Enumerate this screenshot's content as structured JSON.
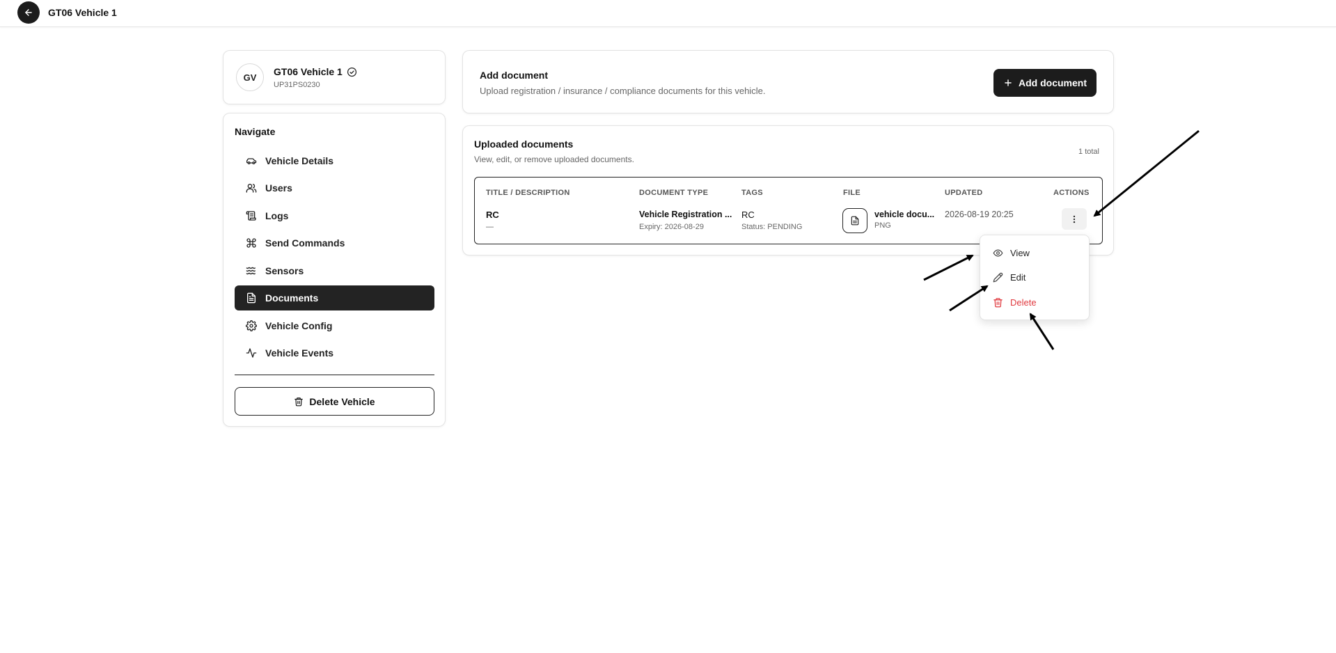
{
  "header": {
    "title": "GT06 Vehicle 1",
    "back_icon": "arrow-left-icon"
  },
  "vehicle": {
    "initials": "GV",
    "name": "GT06 Vehicle 1",
    "registration": "UP31PS0230"
  },
  "nav": {
    "heading": "Navigate",
    "items": [
      {
        "label": "Vehicle Details",
        "icon": "car-icon",
        "active": false
      },
      {
        "label": "Users",
        "icon": "users-icon",
        "active": false
      },
      {
        "label": "Logs",
        "icon": "scroll-icon",
        "active": false
      },
      {
        "label": "Send Commands",
        "icon": "command-icon",
        "active": false
      },
      {
        "label": "Sensors",
        "icon": "waves-icon",
        "active": false
      },
      {
        "label": "Documents",
        "icon": "file-text-icon",
        "active": true
      },
      {
        "label": "Vehicle Config",
        "icon": "gear-icon",
        "active": false
      },
      {
        "label": "Vehicle Events",
        "icon": "activity-icon",
        "active": false
      }
    ],
    "delete_label": "Delete Vehicle"
  },
  "add_document": {
    "title": "Add document",
    "description": "Upload registration / insurance / compliance documents for this vehicle.",
    "button_label": "Add document"
  },
  "documents": {
    "title": "Uploaded documents",
    "description": "View, edit, or remove uploaded documents.",
    "total": "1 total",
    "columns": [
      "TITLE / DESCRIPTION",
      "DOCUMENT TYPE",
      "TAGS",
      "FILE",
      "UPDATED",
      "ACTIONS"
    ],
    "rows": [
      {
        "title": "RC",
        "description": "—",
        "document_type": "Vehicle Registration ...",
        "expiry": "Expiry: 2026-08-29",
        "tag": "RC",
        "status": "Status: PENDING",
        "file_name": "vehicle docu...",
        "file_type": "PNG",
        "updated": "2026-08-19 20:25"
      }
    ]
  },
  "menu": {
    "items": [
      {
        "label": "View",
        "icon": "eye-icon"
      },
      {
        "label": "Edit",
        "icon": "pencil-icon"
      },
      {
        "label": "Delete",
        "icon": "trash-icon",
        "color": "#e0393e"
      }
    ]
  },
  "colors": {
    "primary": "#1c1c1c",
    "danger": "#e0393e",
    "muted": "#666666"
  }
}
